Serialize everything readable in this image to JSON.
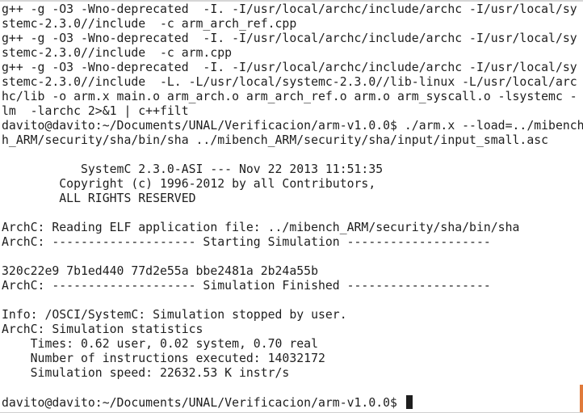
{
  "terminal": {
    "lines": [
      "g++ -g -O3 -Wno-deprecated  -I. -I/usr/local/archc/include/archc -I/usr/local/sy",
      "stemc-2.3.0//include  -c arm_arch_ref.cpp",
      "g++ -g -O3 -Wno-deprecated  -I. -I/usr/local/archc/include/archc -I/usr/local/sy",
      "stemc-2.3.0//include  -c arm.cpp",
      "g++ -g -O3 -Wno-deprecated  -I. -I/usr/local/archc/include/archc -I/usr/local/sy",
      "stemc-2.3.0//include  -L. -L/usr/local/systemc-2.3.0//lib-linux -L/usr/local/arc",
      "hc/lib -o arm.x main.o arm_arch.o arm_arch_ref.o arm.o arm_syscall.o -lsystemc -",
      "lm  -larchc 2>&1 | c++filt",
      "davito@davito:~/Documents/UNAL/Verificacion/arm-v1.0.0$ ./arm.x --load=../mibench",
      "h_ARM/security/sha/bin/sha ../mibench_ARM/security/sha/input/input_small.asc",
      "",
      "           SystemC 2.3.0-ASI --- Nov 22 2013 11:51:35",
      "        Copyright (c) 1996-2012 by all Contributors,",
      "        ALL RIGHTS RESERVED",
      "",
      "ArchC: Reading ELF application file: ../mibench_ARM/security/sha/bin/sha",
      "ArchC: -------------------- Starting Simulation --------------------",
      "",
      "320c22e9 7b1ed440 77d2e55a bbe2481a 2b24a55b",
      "ArchC: -------------------- Simulation Finished --------------------",
      "",
      "Info: /OSCI/SystemC: Simulation stopped by user.",
      "ArchC: Simulation statistics",
      "    Times: 0.62 user, 0.02 system, 0.70 real",
      "    Number of instructions executed: 14032172",
      "    Simulation speed: 22632.53 K instr/s",
      "",
      "davito@davito:~/Documents/UNAL/Verificacion/arm-v1.0.0$ "
    ]
  }
}
